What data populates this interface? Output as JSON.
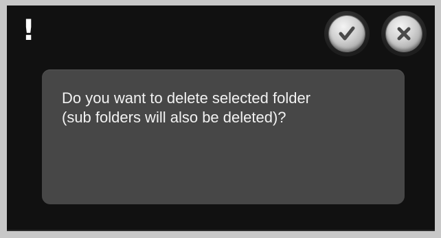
{
  "dialog": {
    "alert_glyph": "!",
    "message": "Do you want to delete selected folder\n(sub folders will also be deleted)?",
    "buttons": {
      "confirm_icon": "checkmark-icon",
      "cancel_icon": "close-icon"
    }
  },
  "colors": {
    "frame": "#c8c8c8",
    "dialog_background": "#111111",
    "message_box": "#474747",
    "text": "#f2f2f2",
    "icon": "#4a4a4a"
  }
}
